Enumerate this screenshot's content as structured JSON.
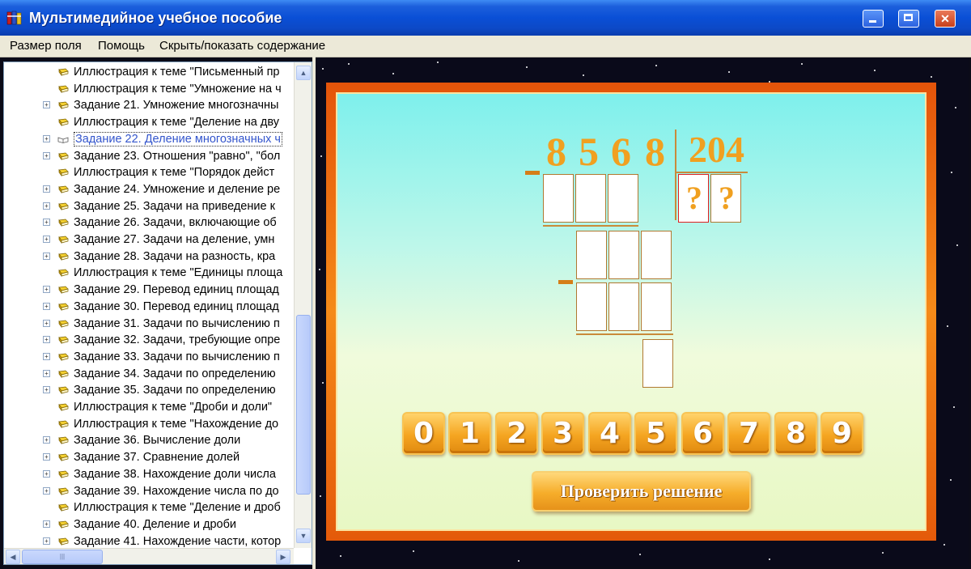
{
  "window": {
    "title": "Мультимедийное учебное пособие",
    "icon": "books-icon",
    "controls": [
      "minimize-icon",
      "maximize-icon",
      "close-icon"
    ]
  },
  "menu": [
    "Размер поля",
    "Помощь",
    "Скрыть/показать содержание"
  ],
  "tree": {
    "items": [
      {
        "label": "Иллюстрация к теме \"Письменный пр",
        "expandable": false
      },
      {
        "label": "Иллюстрация к теме \"Умножение на ч",
        "expandable": false
      },
      {
        "label": "Задание 21. Умножение многозначны",
        "expandable": true
      },
      {
        "label": "Иллюстрация к теме \"Деление на дву",
        "expandable": false
      },
      {
        "label": "Задание 22. Деление многозначных ч",
        "expandable": true,
        "selected": true
      },
      {
        "label": "Задание 23. Отношения \"равно\", \"бол",
        "expandable": true
      },
      {
        "label": "Иллюстрация к теме \"Порядок дейст",
        "expandable": false
      },
      {
        "label": "Задание 24. Умножение и деление ре",
        "expandable": true
      },
      {
        "label": "Задание 25. Задачи на приведение к",
        "expandable": true
      },
      {
        "label": "Задание 26. Задачи, включающие об",
        "expandable": true
      },
      {
        "label": "Задание 27. Задачи на деление, умн",
        "expandable": true
      },
      {
        "label": "Задание 28. Задачи на разность, кра",
        "expandable": true
      },
      {
        "label": "Иллюстрация к теме \"Единицы площа",
        "expandable": false
      },
      {
        "label": "Задание 29. Перевод единиц площад",
        "expandable": true
      },
      {
        "label": "Задание 30. Перевод единиц площад",
        "expandable": true
      },
      {
        "label": "Задание 31. Задачи по вычислению п",
        "expandable": true
      },
      {
        "label": "Задание 32. Задачи, требующие опре",
        "expandable": true
      },
      {
        "label": "Задание 33. Задачи по вычислению п",
        "expandable": true
      },
      {
        "label": "Задание 34. Задачи по определению",
        "expandable": true
      },
      {
        "label": "Задание 35. Задачи по определению",
        "expandable": true
      },
      {
        "label": "Иллюстрация к теме \"Дроби и доли\"",
        "expandable": false
      },
      {
        "label": "Иллюстрация к теме \"Нахождение до",
        "expandable": false
      },
      {
        "label": "Задание 36. Вычисление доли",
        "expandable": true
      },
      {
        "label": "Задание 37. Сравнение долей",
        "expandable": true
      },
      {
        "label": "Задание 38. Нахождение доли числа",
        "expandable": true
      },
      {
        "label": "Задание 39. Нахождение числа по до",
        "expandable": true
      },
      {
        "label": "Иллюстрация к теме \"Деление и дроб",
        "expandable": false
      },
      {
        "label": "Задание 40. Деление и дроби",
        "expandable": true
      },
      {
        "label": "Задание 41. Нахождение части, котор",
        "expandable": true
      }
    ]
  },
  "exercise": {
    "dividend_digits": [
      "8",
      "5",
      "6",
      "8"
    ],
    "divisor": "204",
    "quotient_marks": [
      "?",
      "?"
    ],
    "keypad": [
      "0",
      "1",
      "2",
      "3",
      "4",
      "5",
      "6",
      "7",
      "8",
      "9"
    ],
    "check_button": "Проверить решение"
  }
}
